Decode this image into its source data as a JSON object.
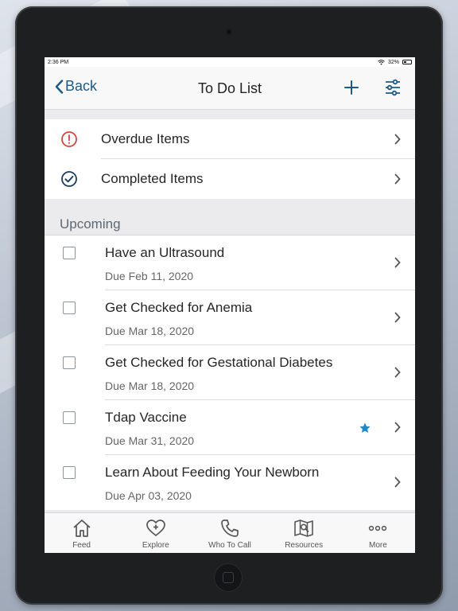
{
  "status_bar": {
    "time": "2:36 PM",
    "battery": "32%",
    "battery_level": 0.32
  },
  "nav": {
    "back_label": "Back",
    "title": "To Do List",
    "add_icon": "plus-icon",
    "filter_icon": "sliders-icon"
  },
  "quick_links": [
    {
      "label": "Overdue Items",
      "icon": "alert-circle-icon",
      "color": "#d9463b"
    },
    {
      "label": "Completed Items",
      "icon": "check-circle-icon",
      "color": "#1d3c5c"
    }
  ],
  "upcoming": {
    "header": "Upcoming",
    "items": [
      {
        "title": "Have an Ultrasound",
        "due": "Due Feb 11, 2020",
        "starred": false
      },
      {
        "title": "Get Checked for Anemia",
        "due": "Due Mar 18, 2020",
        "starred": false
      },
      {
        "title": "Get Checked for Gestational Diabetes",
        "due": "Due Mar 18, 2020",
        "starred": false
      },
      {
        "title": "Tdap Vaccine",
        "due": "Due Mar 31, 2020",
        "starred": true
      },
      {
        "title": "Learn About Feeding Your Newborn",
        "due": "Due Apr 03, 2020",
        "starred": false
      }
    ]
  },
  "tabs": [
    {
      "label": "Feed",
      "icon": "home-icon"
    },
    {
      "label": "Explore",
      "icon": "heart-plus-icon"
    },
    {
      "label": "Who To Call",
      "icon": "phone-icon"
    },
    {
      "label": "Resources",
      "icon": "map-search-icon"
    },
    {
      "label": "More",
      "icon": "more-dots-icon"
    }
  ],
  "colors": {
    "accent": "#1b5a8a",
    "star": "#1f88c9",
    "overdue": "#d9463b"
  }
}
